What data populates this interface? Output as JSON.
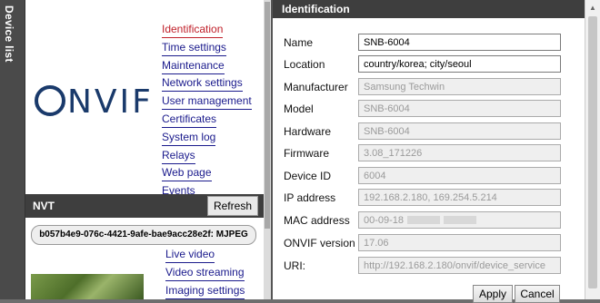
{
  "sidebar": {
    "label": "Device list"
  },
  "logo": {
    "text": "ONVIF"
  },
  "menu_top": [
    {
      "label": "Identification",
      "active": true
    },
    {
      "label": "Time settings"
    },
    {
      "label": "Maintenance"
    },
    {
      "label": "Network settings"
    },
    {
      "label": "User management"
    },
    {
      "label": "Certificates"
    },
    {
      "label": "System log"
    },
    {
      "label": "Relays"
    },
    {
      "label": "Web page"
    },
    {
      "label": "Events"
    }
  ],
  "nvt": {
    "title": "NVT",
    "refresh_label": "Refresh",
    "device_entry": "b057b4e9-076c-4421-9afe-bae9acc28e2f: MJPEG"
  },
  "menu_bottom": [
    {
      "label": "Live video"
    },
    {
      "label": "Video streaming"
    },
    {
      "label": "Imaging settings"
    }
  ],
  "panel": {
    "title": "Identification",
    "fields": [
      {
        "label": "Name",
        "value": "SNB-6004",
        "editable": true
      },
      {
        "label": "Location",
        "value": "country/korea; city/seoul",
        "editable": true
      },
      {
        "label": "Manufacturer",
        "value": "Samsung Techwin",
        "editable": false
      },
      {
        "label": "Model",
        "value": "SNB-6004",
        "editable": false
      },
      {
        "label": "Hardware",
        "value": "SNB-6004",
        "editable": false
      },
      {
        "label": "Firmware",
        "value": "3.08_171226",
        "editable": false
      },
      {
        "label": "Device ID",
        "value": "6004",
        "editable": false
      },
      {
        "label": "IP address",
        "value": "192.168.2.180, 169.254.5.214",
        "editable": false
      },
      {
        "label": "MAC address",
        "value": "00-09-18",
        "editable": false,
        "redacted": true
      },
      {
        "label": "ONVIF version",
        "value": "17.06",
        "editable": false
      },
      {
        "label": "URI:",
        "value": "http://192.168.2.180/onvif/device_service",
        "editable": false
      }
    ],
    "apply_label": "Apply",
    "cancel_label": "Cancel"
  }
}
